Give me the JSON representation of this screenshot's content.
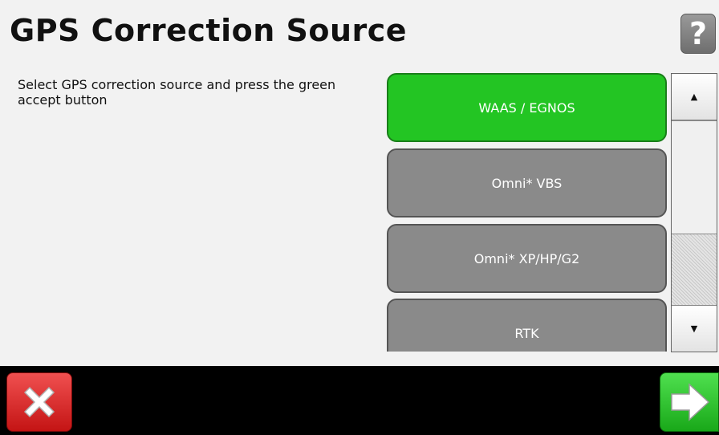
{
  "header": {
    "title": "GPS Correction Source",
    "help_label": "?"
  },
  "instruction": "Select GPS correction source and press the green accept button",
  "options": [
    {
      "label": "WAAS / EGNOS",
      "selected": true
    },
    {
      "label": "Omni* VBS",
      "selected": false
    },
    {
      "label": "Omni* XP/HP/G2",
      "selected": false
    },
    {
      "label": "RTK",
      "selected": false
    }
  ],
  "scrollbar": {
    "up_icon": "▲",
    "down_icon": "▼"
  },
  "footer": {
    "cancel_icon": "close-x-icon",
    "accept_icon": "arrow-right-icon"
  },
  "colors": {
    "selected": "#23c523",
    "unselected": "#8a8a8a",
    "cancel": "#d92a2a",
    "accept": "#2ec42e"
  }
}
